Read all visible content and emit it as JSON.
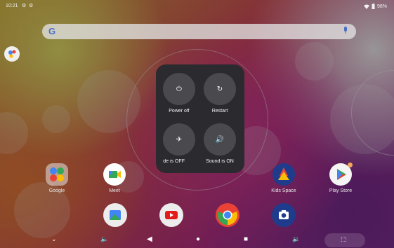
{
  "status_bar": {
    "time": "10:21",
    "battery": "98%",
    "icons": [
      "gear-icon",
      "gear-icon",
      "wifi-icon",
      "battery-icon"
    ]
  },
  "search_bar": {
    "logo": "G",
    "icons": [
      "google-logo",
      "mic-icon"
    ]
  },
  "apps": [
    {
      "label": "Google",
      "icon": "google-folder-icon"
    },
    {
      "label": "Meet",
      "icon": "meet-icon"
    },
    {
      "label": "Kids Space",
      "icon": "kids-space-icon"
    },
    {
      "label": "Play Store",
      "icon": "play-store-icon"
    }
  ],
  "dock": [
    "gallery-icon",
    "youtube-icon",
    "chrome-icon",
    "camera-icon"
  ],
  "power_menu": {
    "buttons": [
      {
        "label": "Power off",
        "icon": "power-icon"
      },
      {
        "label": "Restart",
        "icon": "restart-icon"
      },
      {
        "label": "de is OFF",
        "icon": "airplane-icon"
      },
      {
        "label": "Sound is ON",
        "icon": "speaker-icon"
      }
    ]
  },
  "nav_bar": {
    "icons": [
      "chevron-down-icon",
      "volume-down-icon",
      "back-icon",
      "home-icon",
      "recents-icon",
      "volume-up-icon",
      "screenshot-icon"
    ]
  },
  "colors": {
    "panel": "#2b2a2f",
    "button": "#4a494e",
    "accent_blue": "#4285f4",
    "accent_red": "#ea4335",
    "accent_yellow": "#fbbc05",
    "accent_green": "#34a853"
  }
}
